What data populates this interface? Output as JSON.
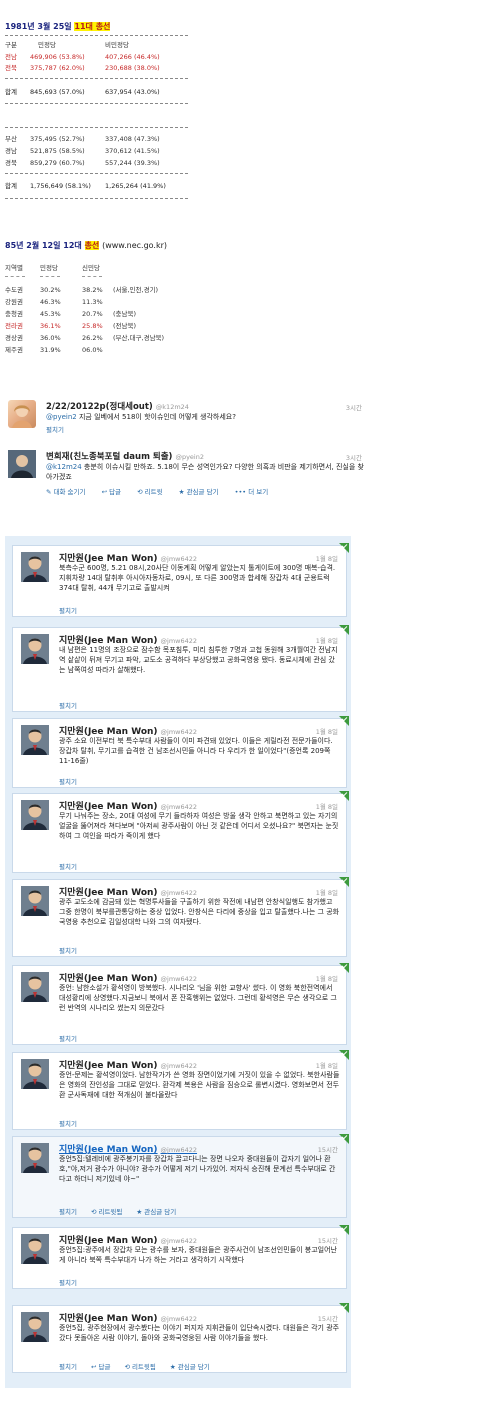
{
  "election1981": {
    "title_date": "1981년 3월 25일",
    "title_hl": "11대 총선",
    "headers": [
      "구분",
      "민정당",
      "비민정당"
    ],
    "rows_a": [
      {
        "region": "전남",
        "a": "469,906 (53.8%)",
        "b": "407,266 (46.4%)",
        "red": true
      },
      {
        "region": "전북",
        "a": "375,787 (62.0%)",
        "b": "230,688 (38.0%)",
        "red": true
      }
    ],
    "total_a": {
      "region": "합계",
      "a": "845,693 (57.0%)",
      "b": "637,954 (43.0%)"
    },
    "rows_b": [
      {
        "region": "부산",
        "a": "375,495 (52.7%)",
        "b": "337,408 (47.3%)"
      },
      {
        "region": "경남",
        "a": "521,875 (58.5%)",
        "b": "370,612 (41.5%)"
      },
      {
        "region": "경북",
        "a": "859,279 (60.7%)",
        "b": "557,244 (39.3%)"
      }
    ],
    "total_b": {
      "region": "합계",
      "a": "1,756,649 (58.1%)",
      "b": "1,265,264 (41.9%)"
    }
  },
  "election1985": {
    "title_date": "85년 2월 12일 12대",
    "title_hl": "총선",
    "title_src": "(www.nec.go.kr)",
    "headers": [
      "지역별",
      "민정당",
      "신민당"
    ],
    "rows": [
      {
        "region": "수도권",
        "a": "30.2%",
        "b": "38.2%",
        "note": "(서울,인천,경기)",
        "red": false
      },
      {
        "region": "강원권",
        "a": "46.3%",
        "b": "11.3%",
        "note": "",
        "red": false
      },
      {
        "region": "충청권",
        "a": "45.3%",
        "b": "20.7%",
        "note": "(충남북)",
        "red": false
      },
      {
        "region": "전라권",
        "a": "36.1%",
        "b": "25.8%",
        "note": "(전남북)",
        "red": true
      },
      {
        "region": "경상권",
        "a": "36.0%",
        "b": "26.2%",
        "note": "(부산,대구,경남북)",
        "red": false
      },
      {
        "region": "제주권",
        "a": "31.9%",
        "b": "06.0%",
        "note": "",
        "red": false
      }
    ]
  },
  "tweet1": {
    "name": "2/22/20122p(정대세out)",
    "handle": "@k12m24",
    "time": "3시간",
    "mention": "@pyein2",
    "text": " 지금 일베에서 518이 핫이슈인데 어떻게 생각하세요?",
    "action": "펼치기"
  },
  "tweet2": {
    "name": "변희재(친노종북포털 daum 퇴출)",
    "handle": "@pyein2",
    "time": "3시간",
    "mention": "@k12m24",
    "text": " 충분히 이슈시킬 만하죠. 5.18이 무슨 성역인가요? 다양한 의혹과 비판을 제기하면서, 진실을 찾아가겠죠",
    "actions": [
      "대화 숨기기",
      "답글",
      "리트윗",
      "관심글 담기",
      "더 보기"
    ]
  },
  "cards": [
    {
      "name": "지만원(Jee Man Won)",
      "handle": "@jmw6422",
      "time": "1월 8일",
      "text": "북측수군 600명, 5.21 08시,20사단 이동계획 어떻게 알았는지 톨게이트에 300명 매복-습격.지휘차량 14대 탈취후 아시아자동차로, 09시, 또 다른 300명과 합세해 장갑차 4대 군용트럭 374대 탈취, 44개 무기고로 출발시켜",
      "actions": [
        "펼치기"
      ]
    },
    {
      "name": "지만원(Jee Man Won)",
      "handle": "@jmw6422",
      "time": "1월 8일",
      "text": "내 남편은 11명의 조장으로 잠수함 목포침투, 미리 침투한 7명과 고첩 동원해 3개월여간 전남지역 샅샅이 뒤져 무기고 파악, 교도소 공격하다 부상당했고 공화국영웅 됐다. 동료시체에 관심 갔는 남쪽여성 따라가 살해했다.",
      "actions": [
        "펼치기"
      ]
    },
    {
      "name": "지만원(Jee Man Won)",
      "handle": "@jmw6422",
      "time": "1월 8일",
      "text": "광주 소요 이전부터 북 특수부대 사람들이 이미 파견돼 있었다. 이들은 게릴라전 전문가들이다. 장갑차 탈취, 무기고를 습격한 건 남조선시민들 아니라 다 우리가 한 일이었다\"(증언록 209쪽 11-16줄)",
      "actions": [
        "펼치기"
      ]
    },
    {
      "name": "지만원(Jee Man Won)",
      "handle": "@jmw6422",
      "time": "1월 8일",
      "text": "무기 나눠주는 장소, 20대 여성에 무기 들라하자 여성은 방울 생각 안하고 북면하고 있는 자기의 얼굴을 뚫어져라 쳐다보며 \"아저씨 광주사람이 아닌 것 같은데 어디서 오셨나요?\" 북면자는 눈짓하여 그 여인을 따라가 죽이게 했다",
      "actions": [
        "펼치기"
      ]
    },
    {
      "name": "지만원(Jee Man Won)",
      "handle": "@jmw6422",
      "time": "1월 8일",
      "text": "광주 교도소에 감금돼 있는 혁명투사들을 구출하기 위한 작전에 내남편 안창식일행도 참가했고 그중 한명이 북부를관통당하는 중상 입었다. 안창식은 다리에 중상을 입고 탈출했다.나는 그 공화국영웅 추천으로 김일성대학 나와 그의 여자됐다.",
      "actions": [
        "펼치기"
      ]
    },
    {
      "name": "지만원(Jee Man Won)",
      "handle": "@jmw6422",
      "time": "1월 8일",
      "text": "증언: 남한소설가 황석영이 방북했다. 시나리오 '님을 위한 교향사' 썼다. 이 영화 북한전역에서 대성황리에 상영했다.지금보니 북에서 폰 잔혹행위는 없었다. 그런데 황석영은 무슨 생각으로 그런 반역의 시나리오 썼는지 의문갔다",
      "actions": [
        "펼치기"
      ]
    },
    {
      "name": "지만원(Jee Man Won)",
      "handle": "@jmw6422",
      "time": "1월 8일",
      "text": "증언-문제는 황석영이었다. 남한작가가 쓴 영화 장면이었기에 거짓이 있을 수 없었다. 북한사람들은 영화의 잔인성을 그대로 믿었다. 환각제 복용은 사람을 짐승으로 롤변시켰다. 영화보면서 전두환 군사독재에 대한 적개심이 불타올랐다",
      "actions": [
        "펼치기"
      ]
    },
    {
      "name": "지만원(Jee Man Won)",
      "handle": "@jmw6422",
      "time": "15시간",
      "text": "증언5집:텔레비에 광주봉기자를 장갑차 끌고다니는 장면 나오자 중대원들이 갑자기 일어나 환호,\"야,저거 광수가 아니야? 광수가 어떻게 저기 나가있어. 저자식 승진해 문계선 특수부대로 간다고 하더니 저기있네 야~\"",
      "actions": [
        "펼치기",
        "리트윗됨",
        "관심글 담기"
      ],
      "selected": true
    },
    {
      "name": "지만원(Jee Man Won)",
      "handle": "@jmw6422",
      "time": "15시간",
      "text": "증언5집:광주에서 장갑차 모는 광수를 보자, 중대원들은 광주사건이 남조선인민들이 봉고일어난 게 아니라 북쪽 특수부대가 나가 하는 거라고 생각하기 시작했다",
      "actions": [
        "펼치기"
      ]
    },
    {
      "name": "지만원(Jee Man Won)",
      "handle": "@jmw6422",
      "time": "15시간",
      "text": "증언5집, 광주현장에서 광수봤다는 이야기 퍼지자 지휘관들이 입단속시켰다. 대원들은 각기 광주 갔다 못돌아온 사람 이야기, 돌아와 공화국영웅된 사람 이야기들을 했다.",
      "actions": [
        "펼치기",
        "답글",
        "리트윗됨",
        "관심글 담기"
      ]
    }
  ]
}
